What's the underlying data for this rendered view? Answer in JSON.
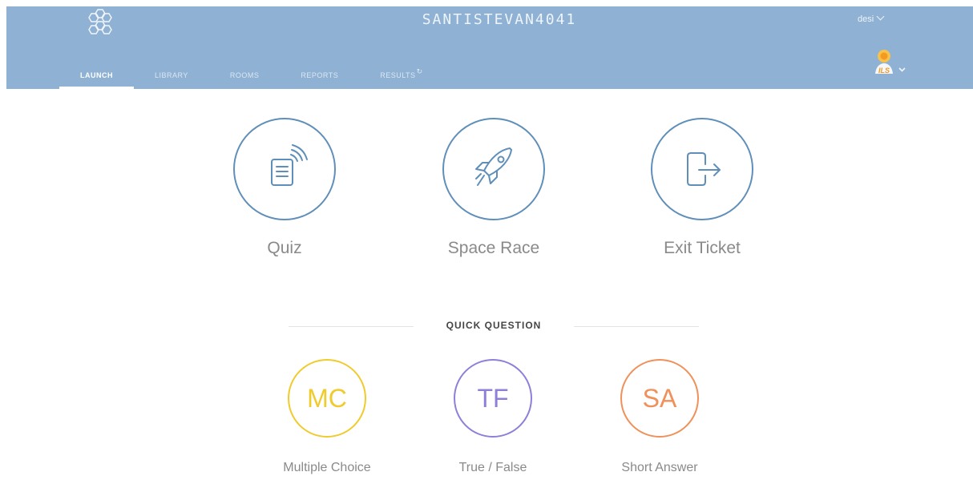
{
  "header": {
    "room_name": "SANTISTEVAN4041",
    "user_name": "desi",
    "tabs": [
      {
        "label": "LAUNCH",
        "active": true
      },
      {
        "label": "LIBRARY",
        "active": false
      },
      {
        "label": "ROOMS",
        "active": false
      },
      {
        "label": "REPORTS",
        "active": false
      },
      {
        "label": "RESULTS",
        "active": false
      }
    ],
    "colors": {
      "bar": "#8fb1d3",
      "accent": "#5f8fb9"
    },
    "icons": {
      "logo": "hexagon-cluster-logo",
      "user_caret": "chevron-down-icon",
      "results_refresh": "refresh-icon",
      "badge": "teacher-badge-icon"
    }
  },
  "activities": [
    {
      "label": "Quiz",
      "icon": "quiz-icon"
    },
    {
      "label": "Space Race",
      "icon": "rocket-icon"
    },
    {
      "label": "Exit Ticket",
      "icon": "exit-door-icon"
    }
  ],
  "quick_question": {
    "title": "QUICK QUESTION",
    "options": [
      {
        "abbr": "MC",
        "label": "Multiple Choice",
        "color": "#efcb2e"
      },
      {
        "abbr": "TF",
        "label": "True / False",
        "color": "#8f7fd9"
      },
      {
        "abbr": "SA",
        "label": "Short Answer",
        "color": "#f0905a"
      }
    ]
  }
}
